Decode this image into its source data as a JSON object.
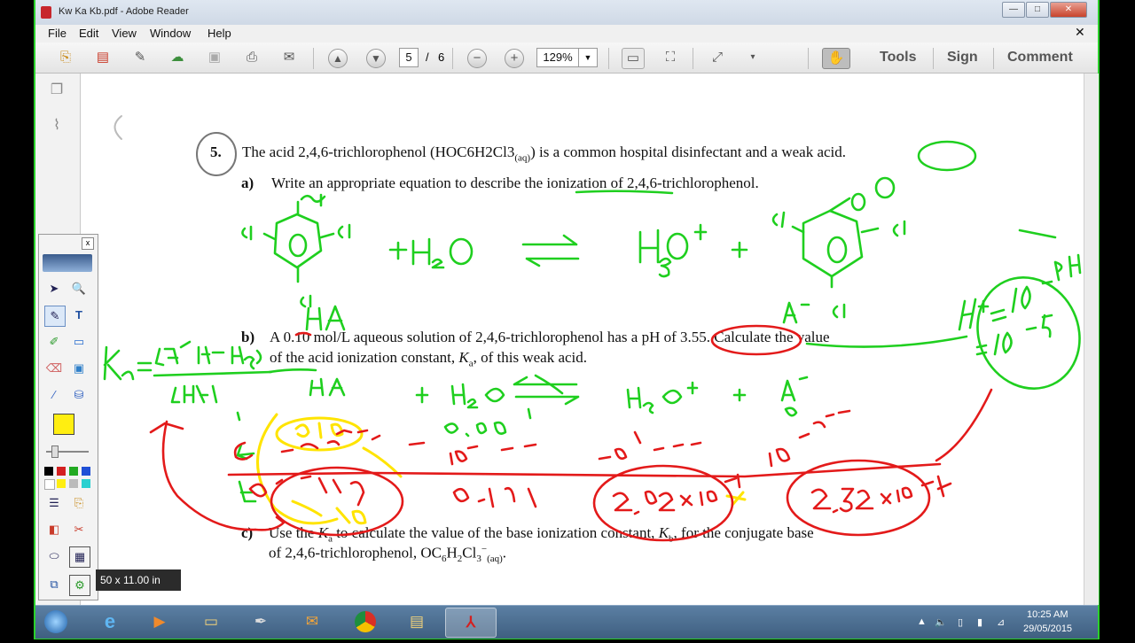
{
  "window": {
    "title": "Kw Ka Kb.pdf - Adobe Reader",
    "min": "—",
    "max": "□",
    "close": "✕"
  },
  "menu": [
    "File",
    "Edit",
    "View",
    "Window",
    "Help"
  ],
  "toolbar": {
    "page_current": "5",
    "page_sep": "/",
    "page_total": "6",
    "zoom": "129%",
    "tools": "Tools",
    "sign": "Sign",
    "comment": "Comment"
  },
  "doc": {
    "q5_num": "5.",
    "q5_text": "The acid 2,4,6-trichlorophenol (HOC6H2Cl3",
    "q5_sub": "(aq)",
    "q5_rest": ") is a common hospital disinfectant and a weak acid.",
    "a_label": "a)",
    "a_text": "Write an appropriate equation to describe the ionization of 2,4,6-trichlorophenol.",
    "b_label": "b)",
    "b_line1": "A 0.10 mol/L aqueous solution of 2,4,6-trichlorophenol has a pH of 3.55. Calculate the value",
    "b_line2a": "of the acid ionization constant, ",
    "b_line2k": "K",
    "b_line2ksub": "a",
    "b_line2b": ", of this weak acid.",
    "c_label": "c)",
    "c_line1a": "Use the ",
    "c_line1k": "K",
    "c_line1ksub": "a",
    "c_line1b": " to calculate the value of the base ionization constant, ",
    "c_line1k2": "K",
    "c_line1k2sub": "b",
    "c_line1c": ", for the conjugate base",
    "c_line2a": "of 2,4,6-trichlorophenol, OC",
    "c_line2s1": "6",
    "c_line2b": "H",
    "c_line2s2": "2",
    "c_line2c": "Cl",
    "c_line2s3": "3",
    "c_line2sup": "−",
    "c_line2s4": "(aq)",
    "c_line2d": "."
  },
  "size_tip": "50 x 11.00 in",
  "palette": {
    "close": "x",
    "swatch_main": "#ffee11",
    "colors": [
      "#000000",
      "#d42020",
      "#22aa22",
      "#1f4fd6",
      "#ffffff",
      "#ffee11",
      "#bbbbbb",
      "#2ad0d0"
    ]
  },
  "tray": {
    "time": "10:25 AM",
    "date": "29/05/2015"
  },
  "taskbar_icons": [
    "windows-start",
    "internet-explorer",
    "media-player",
    "file-explorer",
    "pen-tool",
    "outlook",
    "chrome",
    "folder",
    "adobe-reader"
  ]
}
